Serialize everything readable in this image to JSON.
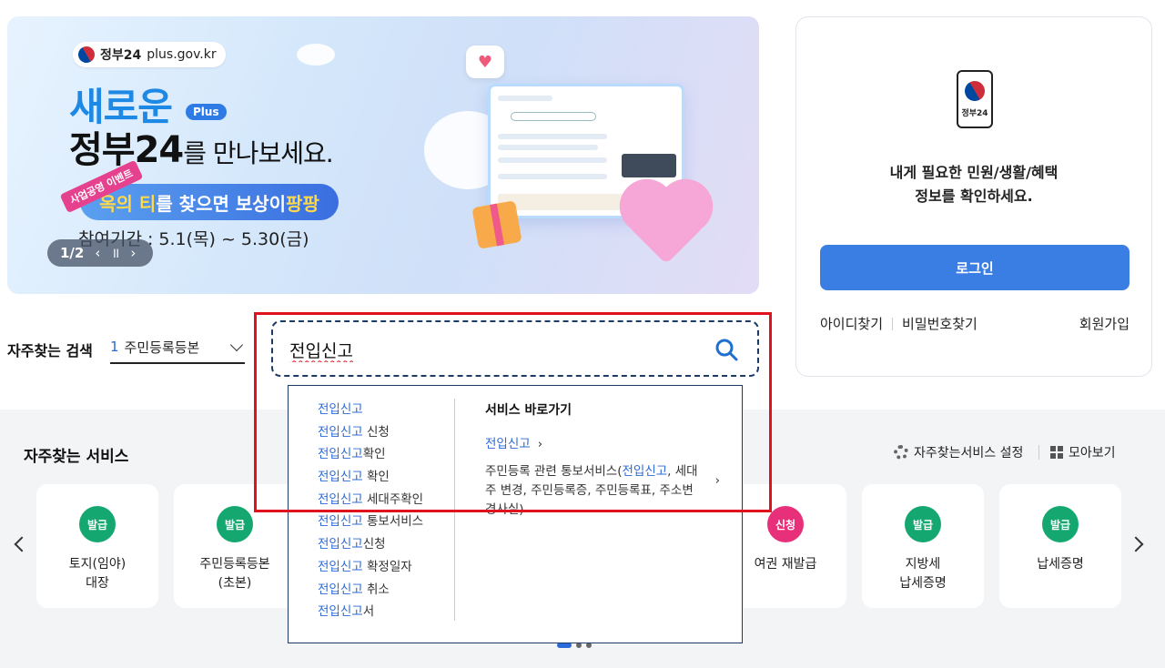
{
  "banner": {
    "site_badge_logo": "정부24",
    "site_badge_url": "plus.gov.kr",
    "title_line1": "새로운",
    "plus_badge": "Plus",
    "title_line2_main": "정부24",
    "title_line2_rest": "를 만나보세요.",
    "event_tag": "사업공영 이벤트",
    "event_text_hl": "옥의 티",
    "event_text_rest": "를 찾으면 보상이 ",
    "event_text_hl2": "팡팡",
    "period": "참여기간 : 5.1(목) ~ 5.30(금)",
    "pager": "1/2",
    "prev_icon": "‹",
    "pause_icon": "॥",
    "next_icon": "›"
  },
  "login": {
    "phone_label": "정부24",
    "message_line1": "내게 필요한 민원/생활/혜택",
    "message_line2": "정보를 확인하세요.",
    "login_button": "로그인",
    "find_id": "아이디찾기",
    "find_pw": "비밀번호찾기",
    "signup": "회원가입"
  },
  "frequent_search": {
    "label": "자주찾는 검색",
    "selected_num": "1",
    "selected_text": "주민등록등본"
  },
  "search": {
    "value": "전입신고"
  },
  "dropdown": {
    "suggestions": [
      {
        "kw": "전입신고",
        "rest": ""
      },
      {
        "kw": "전입신고",
        "rest": " 신청"
      },
      {
        "kw": "전입신고",
        "rest": "확인"
      },
      {
        "kw": "전입신고",
        "rest": " 확인"
      },
      {
        "kw": "전입신고",
        "rest": " 세대주확인"
      },
      {
        "kw": "전입신고",
        "rest": " 통보서비스"
      },
      {
        "kw": "전입신고",
        "rest": "신청"
      },
      {
        "kw": "전입신고",
        "rest": " 확정일자"
      },
      {
        "kw": "전입신고",
        "rest": " 취소"
      },
      {
        "kw": "전입신고",
        "rest": "서"
      }
    ],
    "direct_title": "서비스 바로가기",
    "direct_link1": "전입신고",
    "direct_link2_pre": "주민등록 관련 통보서비스(",
    "direct_link2_kw": "전입신고",
    "direct_link2_post": ", 세대주 변경, 주민등록증, 주민등록표, 주소변경사실)",
    "chevron": "›"
  },
  "services": {
    "title": "자주찾는 서비스",
    "setting": "자주찾는서비스 설정",
    "view_all": "모아보기",
    "colors": {
      "issue": "#14a870",
      "apply": "#e8307a"
    },
    "cards": [
      {
        "tag": "발급",
        "name1": "토지(임야)",
        "name2": "대장"
      },
      {
        "tag": "발급",
        "name1": "주민등록등본",
        "name2": "(초본)"
      },
      {
        "tag": "신청",
        "name1": "여권 재발급",
        "name2": ""
      },
      {
        "tag": "발급",
        "name1": "지방세",
        "name2": "납세증명"
      },
      {
        "tag": "발급",
        "name1": "납세증명",
        "name2": ""
      }
    ]
  }
}
